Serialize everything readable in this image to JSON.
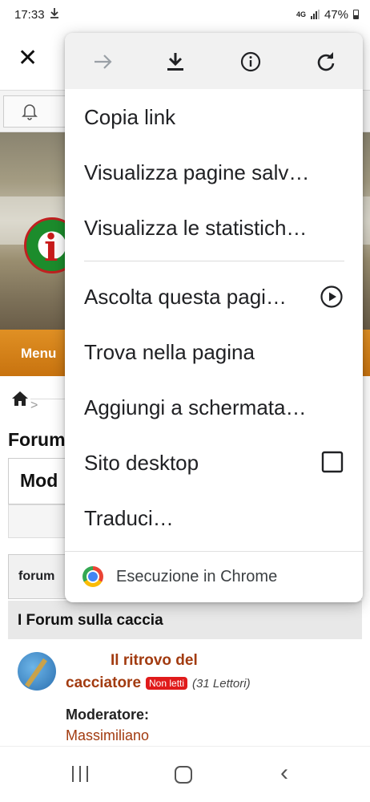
{
  "status_bar": {
    "time": "17:33",
    "network": "4G",
    "battery": "47%"
  },
  "page": {
    "menu_label": "Menu",
    "section_heading": "Forum",
    "moderation_heading": "Mod",
    "table_header": "forum",
    "category": "I Forum sulla caccia",
    "forum_title_line1": "Il ritrovo del",
    "forum_title_line2": "cacciatore",
    "badge": "Non letti",
    "readers": "(31 Lettori)",
    "moderator_label": "Moderatore:",
    "moderator_name": "Massimiliano"
  },
  "menu": {
    "top_icons": [
      "forward-icon",
      "download-icon",
      "info-icon",
      "refresh-icon"
    ],
    "items": [
      {
        "label": "Copia link"
      },
      {
        "label": "Visualizza pagine salv…"
      },
      {
        "label": "Visualizza le statistich…"
      },
      {
        "label": "Ascolta questa pagi…"
      },
      {
        "label": "Trova nella pagina"
      },
      {
        "label": "Aggiungi a schermata…"
      },
      {
        "label": "Sito desktop"
      },
      {
        "label": "Traduci…"
      }
    ],
    "footer": "Esecuzione in Chrome"
  },
  "colors": {
    "accent": "#c8730f",
    "forum_link": "#a23b10",
    "badge": "#e01b1b"
  }
}
